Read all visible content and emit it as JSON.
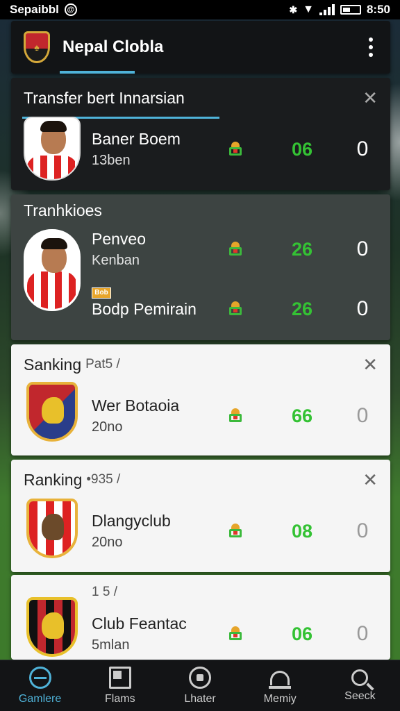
{
  "status_bar": {
    "carrier": "Sepaibbl",
    "time": "8:50"
  },
  "app_bar": {
    "title": "Nepal Clobla"
  },
  "cards": [
    {
      "header": "Transfer bert Innarsian",
      "rows": [
        {
          "name": "Baner Boem",
          "sub": "13ben",
          "score": "06",
          "zero": "0"
        }
      ]
    },
    {
      "header": "Tranhkioes",
      "tag": "Bob",
      "rows": [
        {
          "name": "Penveo",
          "sub": "Kenban",
          "score": "26",
          "zero": "0"
        },
        {
          "name": "Bodp Pemirain",
          "sub": "",
          "score": "26",
          "zero": "0"
        }
      ]
    },
    {
      "header": "Sanking",
      "header_sub": "Pat5 /",
      "rows": [
        {
          "name": "Wer Botaoia",
          "sub": "20no",
          "score": "66",
          "zero": "0"
        }
      ]
    },
    {
      "header": "Ranking",
      "header_sub": "•935 /",
      "rows": [
        {
          "name": "Dlangyclub",
          "sub": "20no",
          "score": "08",
          "zero": "0"
        }
      ]
    },
    {
      "header": "",
      "header_sub": "1 5 /",
      "rows": [
        {
          "name": "Club Feantac",
          "sub": "5mlan",
          "score": "06",
          "zero": "0"
        }
      ]
    }
  ],
  "nav": [
    {
      "label": "Gamlere",
      "icon": "globe-icon",
      "active": true
    },
    {
      "label": "Flams",
      "icon": "frame-icon",
      "active": false
    },
    {
      "label": "Lhater",
      "icon": "ball-icon",
      "active": false
    },
    {
      "label": "Memiy",
      "icon": "stadium-icon",
      "active": false
    },
    {
      "label": "Seeck",
      "icon": "search-icon",
      "active": false
    }
  ],
  "colors": {
    "accent": "#4fb3d9",
    "score_green": "#34c234",
    "club_red": "#c1272d",
    "gold": "#e8b23a"
  }
}
